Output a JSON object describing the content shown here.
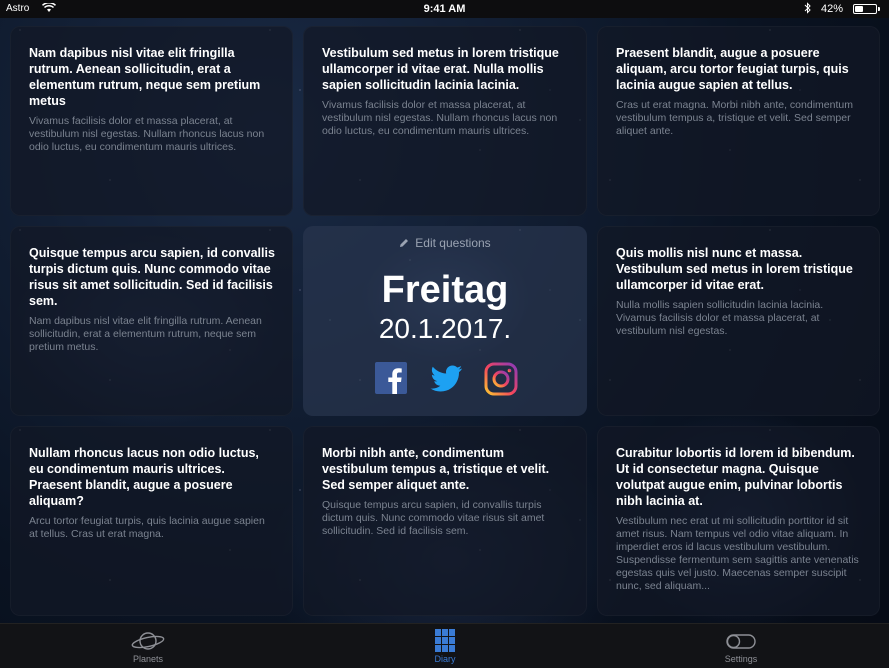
{
  "status_bar": {
    "carrier": "Astro",
    "time": "9:41 AM",
    "battery": "42%",
    "battery_level": 0.42
  },
  "cards": [
    {
      "question": "Nam dapibus nisl vitae elit fringilla rutrum. Aenean sollicitudin, erat a elementum rutrum, neque sem pretium metus",
      "answer": "Vivamus facilisis dolor et massa placerat, at vestibulum nisl egestas. Nullam rhoncus lacus non odio luctus, eu condimentum mauris ultrices."
    },
    {
      "question": "Vestibulum sed metus in lorem tristique ullamcorper id vitae erat. Nulla mollis sapien sollicitudin lacinia lacinia.",
      "answer": "Vivamus facilisis dolor et massa placerat, at vestibulum nisl egestas. Nullam rhoncus lacus non odio luctus, eu condimentum mauris ultrices."
    },
    {
      "question": "Praesent blandit, augue a posuere aliquam, arcu tortor feugiat turpis, quis lacinia augue sapien at tellus.",
      "answer": "Cras ut erat magna. Morbi nibh ante, condimentum vestibulum tempus a, tristique et velit. Sed semper aliquet ante."
    },
    {
      "question": "Quisque tempus arcu sapien, id convallis turpis dictum quis. Nunc commodo vitae risus sit amet sollicitudin. Sed id facilisis sem.",
      "answer": "Nam dapibus nisl vitae elit fringilla rutrum. Aenean sollicitudin, erat a elementum rutrum, neque sem pretium metus."
    },
    {
      "question": "Quis mollis nisl nunc et massa. Vestibulum sed metus in lorem tristique ullamcorper id vitae erat.",
      "answer": "Nulla mollis sapien sollicitudin lacinia lacinia. Vivamus facilisis dolor et massa placerat, at vestibulum nisl egestas."
    },
    {
      "question": "Nullam rhoncus lacus non odio luctus, eu condimentum mauris ultrices. Praesent blandit, augue a posuere aliquam?",
      "answer": "Arcu tortor feugiat turpis, quis lacinia augue sapien at tellus. Cras ut erat magna."
    },
    {
      "question": "Morbi nibh ante, condimentum vestibulum tempus a, tristique et velit. Sed semper aliquet ante.",
      "answer": "Quisque tempus arcu sapien, id convallis turpis dictum quis. Nunc commodo vitae risus sit amet sollicitudin. Sed id facilisis sem."
    },
    {
      "question": "Curabitur lobortis id lorem id bibendum. Ut id consectetur magna. Quisque volutpat augue enim, pulvinar lobortis nibh lacinia at.",
      "answer": "Vestibulum nec erat ut mi sollicitudin porttitor id sit amet risus. Nam tempus vel odio vitae aliquam. In imperdiet eros id lacus vestibulum vestibulum. Suspendisse fermentum sem sagittis ante venenatis egestas quis vel justo. Maecenas semper suscipit nunc, sed aliquam..."
    }
  ],
  "center": {
    "edit_label": "Edit questions",
    "day": "Freitag",
    "date": "20.1.2017."
  },
  "social": {
    "facebook_color": "#3b5998",
    "twitter_color": "#1da1f2"
  },
  "tabs": [
    {
      "label": "Planets",
      "icon": "planet-icon"
    },
    {
      "label": "Diary",
      "icon": "grid-icon"
    },
    {
      "label": "Settings",
      "icon": "toggle-icon"
    }
  ],
  "colors": {
    "accent": "#3a7bd5"
  }
}
